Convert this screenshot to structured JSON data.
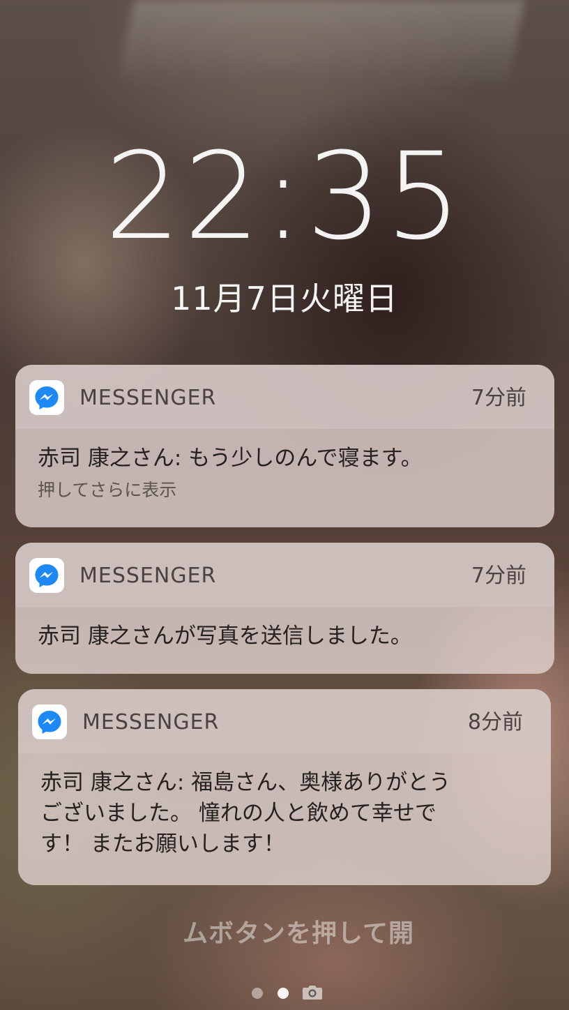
{
  "lockscreen": {
    "time": "22:35",
    "date": "11月7日火曜日"
  },
  "notifications": [
    {
      "app_name": "MESSENGER",
      "time_ago": "7分前",
      "message": "赤司 康之さん: もう少しのんで寝ます。",
      "hint": "押してさらに表示"
    },
    {
      "app_name": "MESSENGER",
      "time_ago": "7分前",
      "message": "赤司 康之さんが写真を送信しました。"
    },
    {
      "app_name": "MESSENGER",
      "time_ago": "8分前",
      "message_lines": [
        "赤司 康之さん: 福島さん、奥様ありがとう",
        "ございました。 憧れの人と飲めて幸せで",
        "す！ またお願いします！"
      ]
    }
  ],
  "bottom_hint": "ムボタンを押して開",
  "icons": {
    "app": "messenger-icon",
    "camera": "camera-icon"
  },
  "colors": {
    "messenger_blue": "#1e88f5",
    "card_background": "#e4d6d4"
  }
}
